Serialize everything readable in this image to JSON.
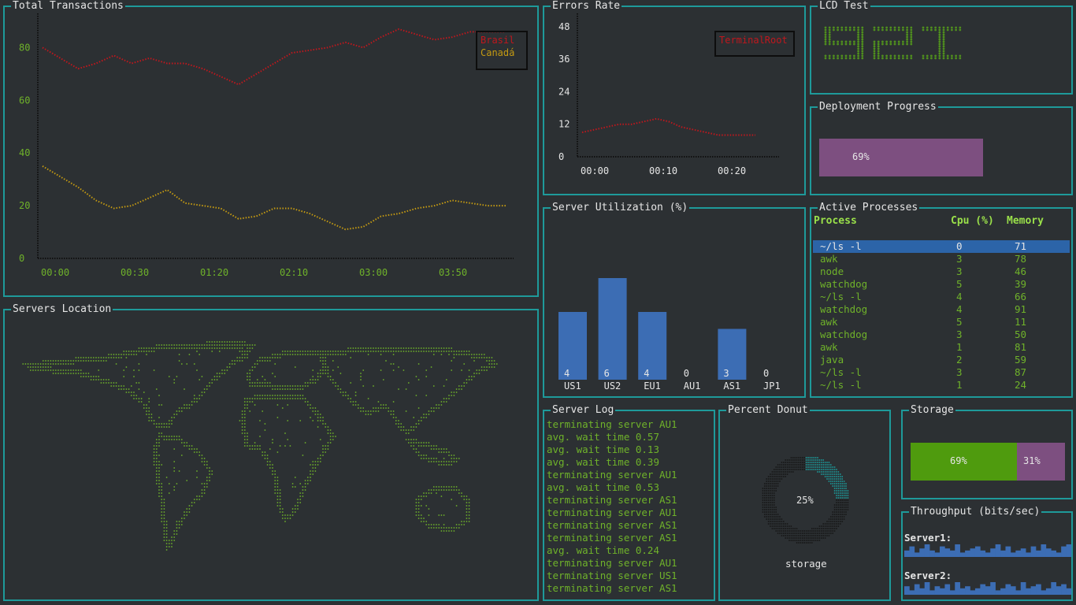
{
  "colors": {
    "border": "#1e9a9a",
    "green": "#6fb22a",
    "red": "#c0171d",
    "orange": "#c49a12",
    "blue": "#3c6db4",
    "purple": "#7d4f80",
    "storage_green": "#4f9b0e"
  },
  "total_transactions": {
    "title": "Total Transactions",
    "legend": [
      "Brasil",
      "Canadá"
    ],
    "chart_data": {
      "type": "line",
      "x_ticks": [
        "00:00",
        "00:30",
        "01:20",
        "02:10",
        "03:00",
        "03:50"
      ],
      "y_ticks": [
        "0",
        "20",
        "40",
        "60",
        "80"
      ],
      "ylim": [
        0,
        90
      ],
      "series": [
        {
          "name": "Brasil",
          "color": "#c0171d",
          "values": [
            80,
            76,
            72,
            74,
            77,
            74,
            76,
            74,
            74,
            72,
            69,
            66,
            70,
            74,
            78,
            79,
            80,
            82,
            80,
            84,
            87,
            85,
            83,
            84,
            86,
            86,
            86
          ]
        },
        {
          "name": "Canadá",
          "color": "#c49a12",
          "values": [
            35,
            31,
            27,
            22,
            19,
            20,
            23,
            26,
            21,
            20,
            19,
            15,
            16,
            19,
            19,
            17,
            14,
            11,
            12,
            16,
            17,
            19,
            20,
            22,
            21,
            20,
            20
          ]
        }
      ]
    }
  },
  "errors_rate": {
    "title": "Errors Rate",
    "legend": [
      "TerminalRoot"
    ],
    "chart_data": {
      "type": "line",
      "x_ticks": [
        "00:00",
        "00:10",
        "00:20"
      ],
      "y_ticks": [
        "0",
        "12",
        "24",
        "36",
        "48"
      ],
      "ylim": [
        0,
        50
      ],
      "series": [
        {
          "name": "TerminalRoot",
          "color": "#c0171d",
          "values": [
            9,
            10,
            11,
            12,
            12,
            13,
            14,
            13,
            11,
            10,
            9,
            8,
            8,
            8,
            8
          ]
        }
      ]
    }
  },
  "lcd": {
    "title": "LCD Test",
    "value": "92I"
  },
  "deployment": {
    "title": "Deployment Progress",
    "percent": 69,
    "label": "69%"
  },
  "server_utilization": {
    "title": "Server Utilization (%)",
    "chart_data": {
      "type": "bar",
      "categories": [
        "US1",
        "US2",
        "EU1",
        "AU1",
        "AS1",
        "JP1"
      ],
      "values": [
        4,
        6,
        4,
        0,
        3,
        0
      ],
      "ylim": [
        0,
        6
      ]
    }
  },
  "processes": {
    "title": "Active Processes",
    "headers": [
      "Process",
      "Cpu (%)",
      "Memory"
    ],
    "rows": [
      [
        "~/ls -l",
        "0",
        "71"
      ],
      [
        "awk",
        "3",
        "78"
      ],
      [
        "node",
        "3",
        "46"
      ],
      [
        "watchdog",
        "5",
        "39"
      ],
      [
        "~/ls -l",
        "4",
        "66"
      ],
      [
        "watchdog",
        "4",
        "91"
      ],
      [
        "awk",
        "5",
        "11"
      ],
      [
        "watchdog",
        "3",
        "50"
      ],
      [
        "awk",
        "1",
        "81"
      ],
      [
        "java",
        "2",
        "59"
      ],
      [
        "~/ls -l",
        "3",
        "87"
      ],
      [
        "~/ls -l",
        "1",
        "24"
      ]
    ]
  },
  "servers_location": {
    "title": "Servers Location"
  },
  "server_log": {
    "title": "Server Log",
    "lines": [
      "terminating server AU1",
      "avg. wait time 0.57",
      "avg. wait time 0.13",
      "avg. wait time 0.39",
      "terminating server AU1",
      "avg. wait time 0.53",
      "terminating server AS1",
      "terminating server AU1",
      "terminating server AS1",
      "terminating server AS1",
      "avg. wait time 0.24",
      "terminating server AU1",
      "terminating server US1",
      "terminating server AS1"
    ]
  },
  "donut": {
    "title": "Percent Donut",
    "percent": 25,
    "label": "25%",
    "caption": "storage"
  },
  "storage": {
    "title": "Storage",
    "used": 69,
    "free": 31,
    "used_label": "69%",
    "free_label": "31%"
  },
  "throughput": {
    "title": "Throughput (bits/sec)",
    "servers": [
      {
        "name": "Server1:",
        "values": [
          2,
          4,
          1,
          3,
          5,
          2,
          1,
          4,
          3,
          2,
          5,
          1,
          2,
          3,
          4,
          2,
          1,
          3,
          5,
          2,
          4,
          1,
          2,
          3,
          1,
          4,
          2,
          5,
          3,
          2,
          1,
          4,
          5
        ]
      },
      {
        "name": "Server2:",
        "values": [
          3,
          1,
          4,
          2,
          5,
          1,
          3,
          2,
          4,
          1,
          5,
          2,
          3,
          1,
          2,
          4,
          3,
          5,
          1,
          2,
          4,
          3,
          1,
          5,
          2,
          3,
          4,
          1,
          2,
          5,
          3,
          4,
          2
        ]
      }
    ]
  }
}
